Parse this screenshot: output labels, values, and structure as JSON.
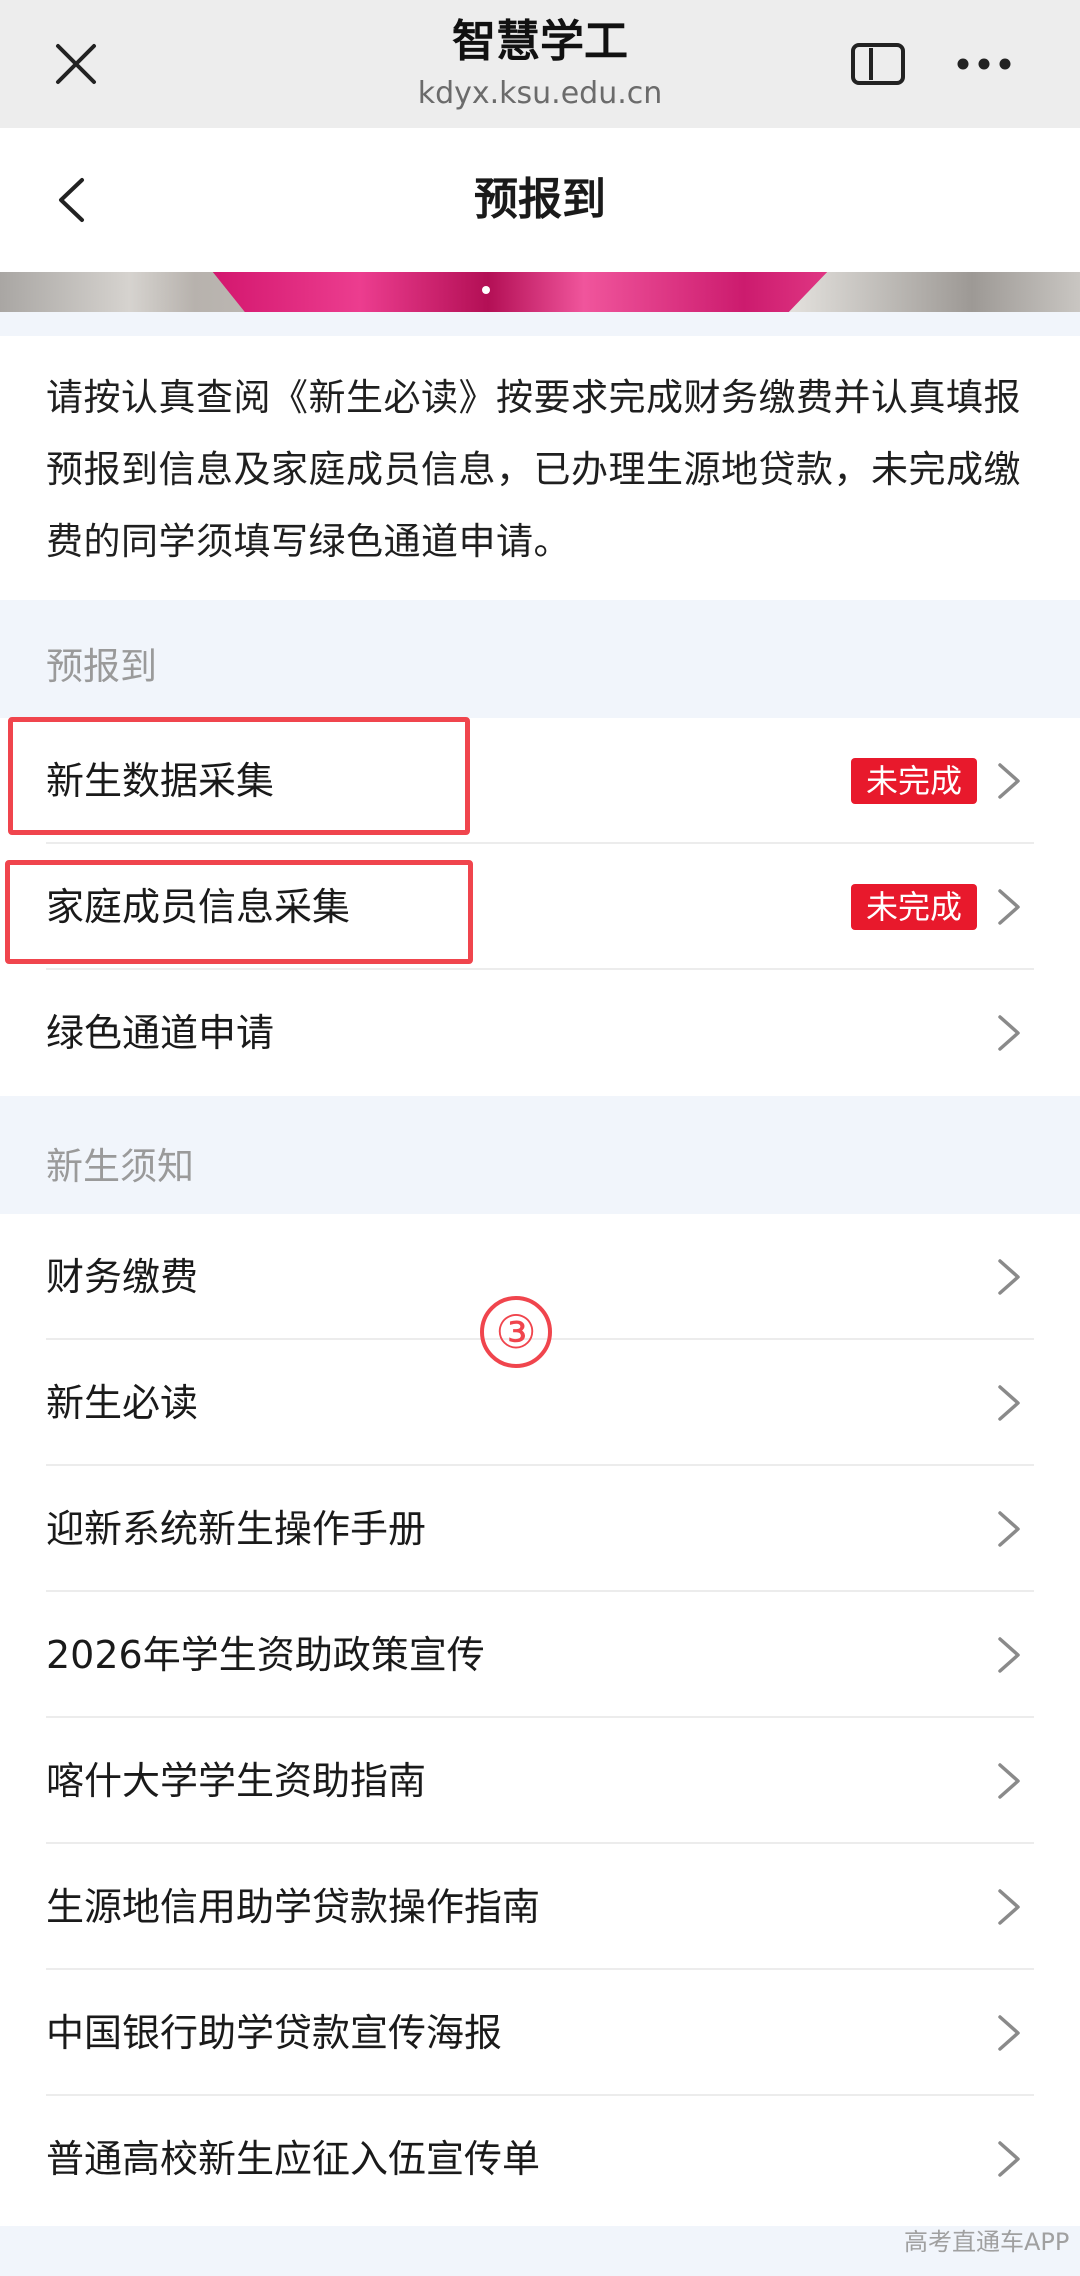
{
  "browser": {
    "title": "智慧学工",
    "url": "kdyx.ksu.edu.cn",
    "icons": {
      "close": "close-icon",
      "window": "window-icon",
      "more": "more-icon"
    }
  },
  "header": {
    "title": "预报到",
    "back_icon": "chevron-left-icon"
  },
  "notice": {
    "text": "请按认真查阅《新生必读》按要求完成财务缴费并认真填报预报到信息及家庭成员信息，已办理生源地贷款，未完成缴费的同学须填写绿色通道申请。"
  },
  "sections": [
    {
      "title": "预报到",
      "items": [
        {
          "label": "新生数据采集",
          "badge": "未完成"
        },
        {
          "label": "家庭成员信息采集",
          "badge": "未完成"
        },
        {
          "label": "绿色通道申请"
        }
      ]
    },
    {
      "title": "新生须知",
      "items": [
        {
          "label": "财务缴费"
        },
        {
          "label": "新生必读"
        },
        {
          "label": "迎新系统新生操作手册"
        },
        {
          "label": "2026年学生资助政策宣传"
        },
        {
          "label": "喀什大学学生资助指南"
        },
        {
          "label": "生源地信用助学贷款操作指南"
        },
        {
          "label": "中国银行助学贷款宣传海报"
        },
        {
          "label": "普通高校新生应征入伍宣传单"
        }
      ]
    }
  ],
  "annotation": {
    "marker": "③"
  },
  "watermark": "高考直通车APP",
  "colors": {
    "badge": "#e8192c",
    "highlight": "#f0454d",
    "section_bg": "#f1f5fb",
    "topbar_bg": "#ededed"
  }
}
